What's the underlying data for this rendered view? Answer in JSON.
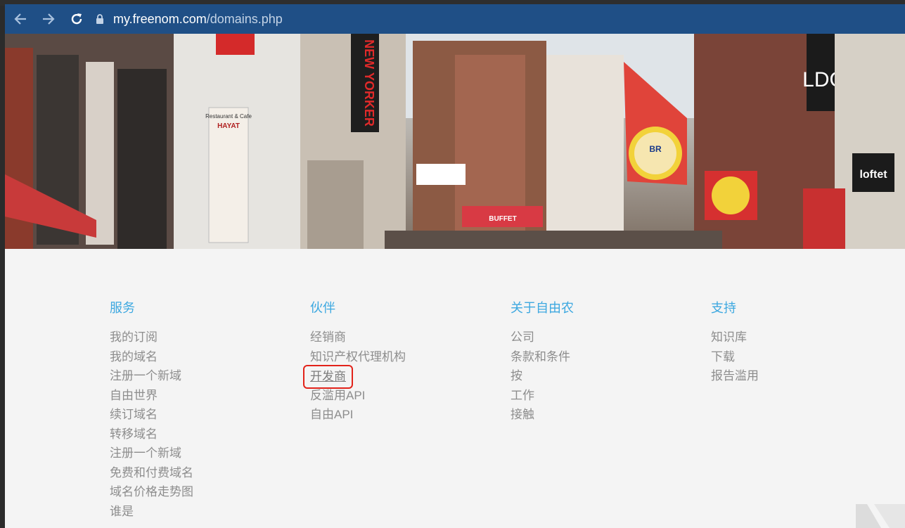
{
  "browser": {
    "url_domain": "my.freenom.com",
    "url_path": "/domains.php",
    "back_icon": "arrow-left-icon",
    "forward_icon": "arrow-right-icon",
    "reload_icon": "reload-icon",
    "lock_icon": "lock-icon"
  },
  "hero": {
    "signs": {
      "newyorker": "NEW YORKER",
      "restaurant": "Restaurant & Cafe",
      "hayat": "HAYAT",
      "aldo": "LDO",
      "loftet": "loftet",
      "buffet": "BUFFET",
      "br": "BR"
    }
  },
  "footer": {
    "services": {
      "title": "服务",
      "links": [
        "我的订阅",
        "我的域名",
        "注册一个新域",
        "自由世界",
        "续订域名",
        "转移域名",
        "注册一个新域",
        "免费和付费域名",
        "域名价格走势图",
        "谁是"
      ]
    },
    "partners": {
      "title": "伙伴",
      "links": [
        "经销商",
        "知识产权代理机构",
        "开发商",
        "反滥用API",
        "自由API"
      ]
    },
    "about": {
      "title": "关于自由农",
      "links": [
        "公司",
        "条款和条件",
        "按",
        "工作",
        "接触"
      ]
    },
    "support": {
      "title": "支持",
      "links": [
        "知识库",
        "下载",
        "报告滥用"
      ]
    }
  },
  "colors": {
    "toolbar": "#1f4f86",
    "accent": "#3da8e0",
    "link": "#8d8d8d",
    "highlight_border": "#e2231a"
  }
}
